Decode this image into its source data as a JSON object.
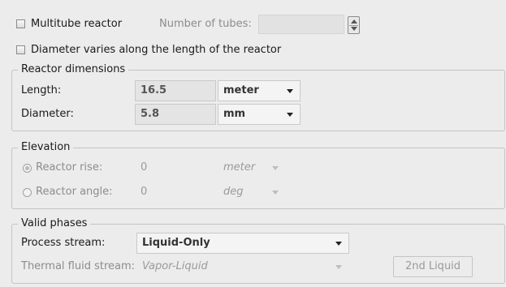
{
  "top": {
    "multitube_label": "Multitube reactor",
    "multitube_checked": false,
    "tubes_label": "Number of tubes:",
    "tubes_value": "",
    "diameter_varies_label": "Diameter varies along the length of the reactor",
    "diameter_varies_checked": false
  },
  "reactor_dimensions": {
    "title": "Reactor dimensions",
    "length_label": "Length:",
    "length_value": "16.5",
    "length_unit": "meter",
    "diameter_label": "Diameter:",
    "diameter_value": "5.8",
    "diameter_unit": "mm"
  },
  "elevation": {
    "title": "Elevation",
    "rise_label": "Reactor rise:",
    "rise_value": "0",
    "rise_unit": "meter",
    "rise_selected": true,
    "angle_label": "Reactor angle:",
    "angle_value": "0",
    "angle_unit": "deg",
    "angle_selected": false
  },
  "valid_phases": {
    "title": "Valid phases",
    "process_label": "Process stream:",
    "process_value": "Liquid-Only",
    "thermal_label": "Thermal fluid stream:",
    "thermal_value": "Vapor-Liquid",
    "second_liquid_label": "2nd Liquid"
  }
}
